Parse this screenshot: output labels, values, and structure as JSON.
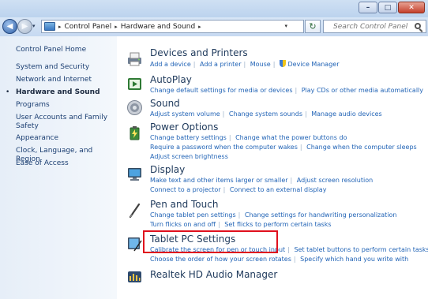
{
  "window": {
    "minimize_glyph": "–",
    "maximize_glyph": "□",
    "close_glyph": "✕"
  },
  "navbar": {
    "back_glyph": "◀",
    "forward_glyph": "▶",
    "recent_glyph": "▾",
    "breadcrumbs": [
      "Control Panel",
      "Hardware and Sound"
    ],
    "breadcrumb_sep": "▸",
    "dropdown_glyph": "▾",
    "refresh_glyph": "↻",
    "search_placeholder": "Search Control Panel"
  },
  "sidebar": {
    "items": [
      {
        "label": "Control Panel Home"
      },
      {
        "label": "System and Security"
      },
      {
        "label": "Network and Internet"
      },
      {
        "label": "Hardware and Sound",
        "current": true
      },
      {
        "label": "Programs"
      },
      {
        "label": "User Accounts and Family Safety"
      },
      {
        "label": "Appearance"
      },
      {
        "label": "Clock, Language, and Region"
      },
      {
        "label": "Ease of Access"
      }
    ],
    "bullet": "•"
  },
  "categories": [
    {
      "title": "Devices and Printers",
      "icon": "printer-icon",
      "lines": [
        [
          "Add a device",
          "Add a printer",
          "Mouse",
          "Device Manager"
        ]
      ]
    },
    {
      "title": "AutoPlay",
      "icon": "autoplay-icon",
      "lines": [
        [
          "Change default settings for media or devices",
          "Play CDs or other media automatically"
        ]
      ]
    },
    {
      "title": "Sound",
      "icon": "speaker-icon",
      "lines": [
        [
          "Adjust system volume",
          "Change system sounds",
          "Manage audio devices"
        ]
      ]
    },
    {
      "title": "Power Options",
      "icon": "battery-icon",
      "lines": [
        [
          "Change battery settings",
          "Change what the power buttons do"
        ],
        [
          "Require a password when the computer wakes",
          "Change when the computer sleeps"
        ],
        [
          "Adjust screen brightness"
        ]
      ]
    },
    {
      "title": "Display",
      "icon": "monitor-icon",
      "lines": [
        [
          "Make text and other items larger or smaller",
          "Adjust screen resolution"
        ],
        [
          "Connect to a projector",
          "Connect to an external display"
        ]
      ]
    },
    {
      "title": "Pen and Touch",
      "icon": "pen-icon",
      "lines": [
        [
          "Change tablet pen settings",
          "Change settings for handwriting personalization"
        ],
        [
          "Turn flicks on and off",
          "Set flicks to perform certain tasks"
        ]
      ]
    },
    {
      "title": "Tablet PC Settings",
      "icon": "tablet-icon",
      "lines": [
        [
          "Calibrate the screen for pen or touch input",
          "Set tablet buttons to perform certain tasks"
        ],
        [
          "Choose the order of how your screen rotates",
          "Specify which hand you write with"
        ]
      ]
    },
    {
      "title": "Realtek HD Audio Manager",
      "icon": "audio-manager-icon",
      "lines": []
    }
  ],
  "colors": {
    "link": "#2264b6",
    "title": "#1e395b",
    "highlight": "#e0101d"
  }
}
